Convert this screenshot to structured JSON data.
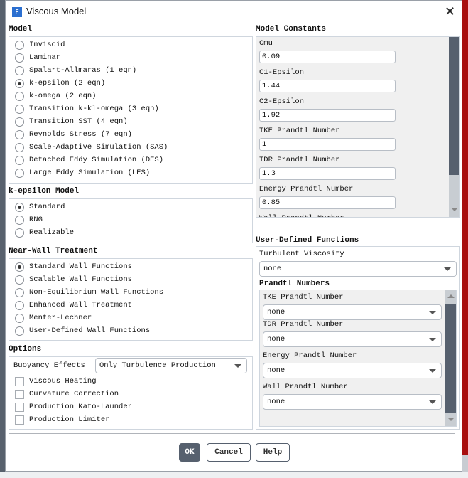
{
  "window": {
    "title": "Viscous Model",
    "app_icon_letter": "F",
    "close_glyph": "✕"
  },
  "model": {
    "label": "Model",
    "options": [
      "Inviscid",
      "Laminar",
      "Spalart-Allmaras (1 eqn)",
      "k-epsilon (2 eqn)",
      "k-omega (2 eqn)",
      "Transition k-kl-omega (3 eqn)",
      "Transition SST (4 eqn)",
      "Reynolds Stress (7 eqn)",
      "Scale-Adaptive Simulation (SAS)",
      "Detached Eddy Simulation (DES)",
      "Large Eddy Simulation (LES)"
    ],
    "selected": 3
  },
  "kepsilon": {
    "label": "k-epsilon Model",
    "options": [
      "Standard",
      "RNG",
      "Realizable"
    ],
    "selected": 0
  },
  "nearwall": {
    "label": "Near-Wall Treatment",
    "options": [
      "Standard Wall Functions",
      "Scalable Wall Functions",
      "Non-Equilibrium Wall Functions",
      "Enhanced Wall Treatment",
      "Menter-Lechner",
      "User-Defined Wall Functions"
    ],
    "selected": 0
  },
  "options": {
    "label": "Options",
    "buoyancy_label": "Buoyancy Effects",
    "buoyancy_value": "Only Turbulence Production",
    "checkboxes": [
      {
        "label": "Viscous Heating",
        "checked": false
      },
      {
        "label": "Curvature Correction",
        "checked": false
      },
      {
        "label": "Production Kato-Launder",
        "checked": false
      },
      {
        "label": "Production Limiter",
        "checked": false
      }
    ]
  },
  "constants": {
    "label": "Model Constants",
    "items": [
      {
        "label": "Cmu",
        "value": "0.09"
      },
      {
        "label": "C1-Epsilon",
        "value": "1.44"
      },
      {
        "label": "C2-Epsilon",
        "value": "1.92"
      },
      {
        "label": "TKE Prandtl Number",
        "value": "1"
      },
      {
        "label": "TDR Prandtl Number",
        "value": "1.3"
      },
      {
        "label": "Energy Prandtl Number",
        "value": "0.85"
      },
      {
        "label": "Wall Prandtl Number",
        "value": ""
      }
    ]
  },
  "udf": {
    "label": "User-Defined Functions",
    "turb_visc_label": "Turbulent Viscosity",
    "turb_visc_value": "none",
    "prandtl_label": "Prandtl Numbers",
    "prandtl": [
      {
        "label": "TKE Prandtl Number",
        "value": "none"
      },
      {
        "label": "TDR Prandtl Number",
        "value": "none"
      },
      {
        "label": "Energy Prandtl Number",
        "value": "none"
      },
      {
        "label": "Wall Prandtl Number",
        "value": "none"
      }
    ]
  },
  "buttons": {
    "ok": "OK",
    "cancel": "Cancel",
    "help": "Help"
  }
}
